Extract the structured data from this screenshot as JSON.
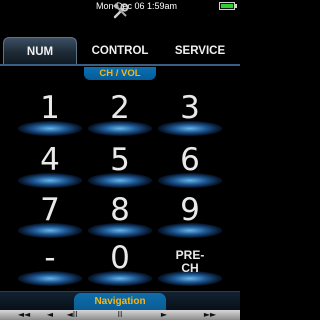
{
  "status_bar": {
    "datetime": "Mon Dec 06  1:59am",
    "app_icon": "tools-icon",
    "battery_icon": "battery-icon"
  },
  "tabs": [
    {
      "label": "NUM",
      "active": true
    },
    {
      "label": "CONTROL",
      "active": false
    },
    {
      "label": "SERVICE",
      "active": false
    }
  ],
  "sections": {
    "ch_vol": "CH / VOL",
    "navigation": "Navigation"
  },
  "keypad": {
    "keys": [
      {
        "label": "1"
      },
      {
        "label": "2"
      },
      {
        "label": "3"
      },
      {
        "label": "4"
      },
      {
        "label": "5"
      },
      {
        "label": "6"
      },
      {
        "label": "7"
      },
      {
        "label": "8"
      },
      {
        "label": "9"
      },
      {
        "label": "-"
      },
      {
        "label": "0"
      },
      {
        "label": "PRE-\nCH"
      }
    ]
  },
  "transport": {
    "buttons": [
      "◄◄",
      "◄",
      "◄II",
      "II",
      "►",
      "►►"
    ],
    "icons": [
      "rewind-icon",
      "previous-icon",
      "step-back-icon",
      "pause-icon",
      "play-icon",
      "fast-forward-icon"
    ]
  },
  "colors": {
    "accent_text": "#f5b716",
    "tab_active": "#2b3c4e",
    "section_bar": "#0a67a4",
    "key_glow": "#4aa3e6"
  }
}
